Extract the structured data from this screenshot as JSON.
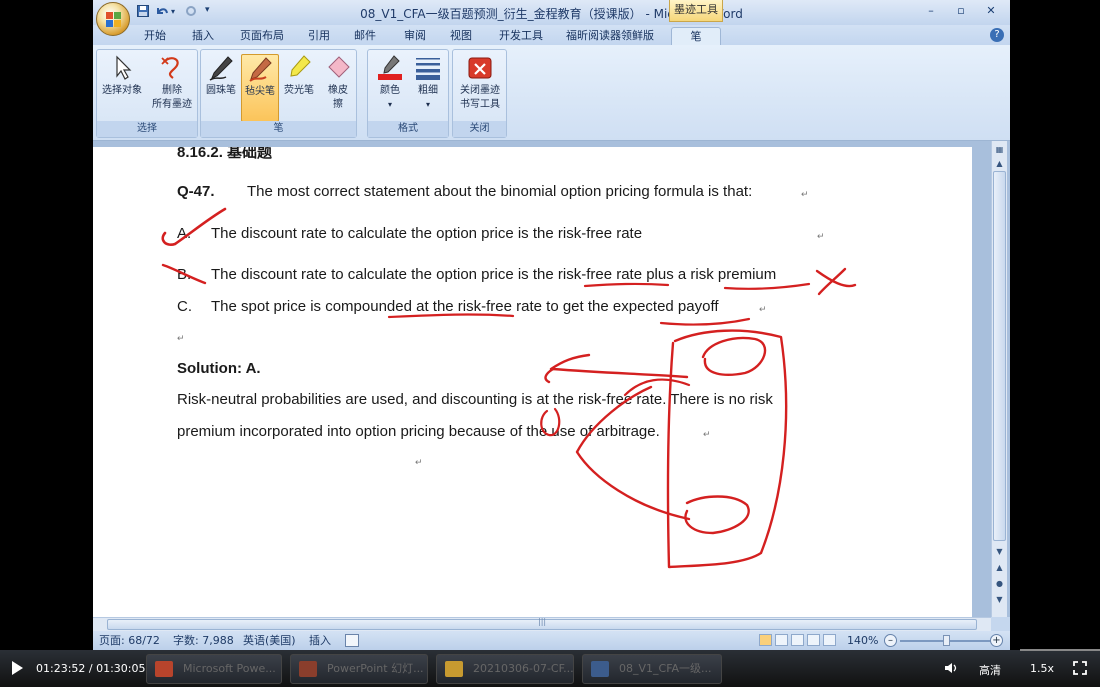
{
  "window": {
    "title": "08_V1_CFA一级百题预测_衍生_金程教育（授课版） - Microsoft Word",
    "context_tab_header": "墨迹工具",
    "buttons": {
      "minimize": "–",
      "maximize": "▫",
      "close": "✕"
    }
  },
  "tabs": [
    {
      "label": "开始"
    },
    {
      "label": "插入"
    },
    {
      "label": "页面布局"
    },
    {
      "label": "引用"
    },
    {
      "label": "邮件"
    },
    {
      "label": "审阅"
    },
    {
      "label": "视图"
    },
    {
      "label": "开发工具"
    },
    {
      "label": "福昕阅读器领鲜版"
    },
    {
      "label": "笔"
    }
  ],
  "help": "?",
  "ribbon": {
    "groups": [
      {
        "label": "选择",
        "buttons": [
          "选择对象",
          "删除",
          "所有墨迹"
        ]
      },
      {
        "label": "笔",
        "buttons": [
          "圆珠笔",
          "毡尖笔",
          "荧光笔",
          "橡皮",
          "擦"
        ]
      },
      {
        "label": "格式",
        "buttons": [
          "颜色",
          "粗细"
        ]
      },
      {
        "label": "关闭",
        "buttons": [
          "关闭墨迹",
          "书写工具"
        ]
      }
    ]
  },
  "document": {
    "heading": "8.16.2.  基础题",
    "question_num": "Q-47.",
    "question": "The most correct statement about the binomial option pricing formula is that:",
    "options": [
      {
        "letter": "A.",
        "text": "The discount rate to calculate the option price is the risk-free rate"
      },
      {
        "letter": "B.",
        "text": "The discount rate to calculate the option price is the risk-free rate plus a risk premium"
      },
      {
        "letter": "C.",
        "text": "The spot price is compounded at the risk-free rate to get the expected payoff"
      }
    ],
    "solution_label": "Solution: A.",
    "solution_line1": "Risk-neutral probabilities are used, and discounting is at the risk-free rate. There is no risk",
    "solution_line2": "premium incorporated into option pricing because of the use of arbitrage.",
    "para_mark": "↵",
    "ink_color": "#d42020"
  },
  "statusbar": {
    "page": "页面: 68/72",
    "words": "字数: 7,988",
    "language": "英语(美国)",
    "mode": "插入",
    "zoom": "140%"
  },
  "taskbar": {
    "items": [
      "Microsoft Powe...",
      "PowerPoint 幻灯...",
      "20210306-07-CF...",
      "08_V1_CFA一级..."
    ]
  },
  "player": {
    "time": "01:23:52 / 01:30:05",
    "quality": "高清",
    "speed": "1.5x"
  }
}
